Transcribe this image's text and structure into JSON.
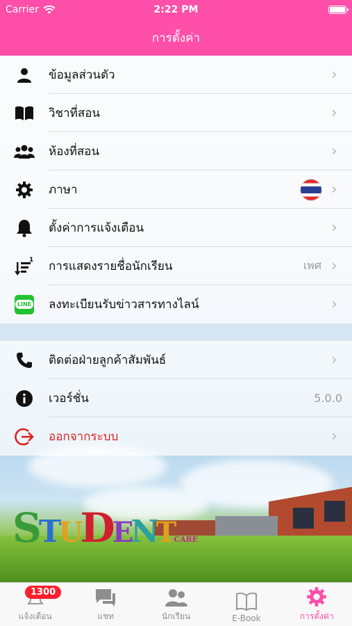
{
  "status": {
    "carrier": "Carrier",
    "time": "2:22 PM"
  },
  "nav": {
    "title": "การตั้งค่า"
  },
  "menu": {
    "group1": [
      {
        "label": "ข้อมูลส่วนตัว",
        "icon": "person-icon",
        "value": ""
      },
      {
        "label": "วิชาที่สอน",
        "icon": "book-icon",
        "value": ""
      },
      {
        "label": "ห้องที่สอน",
        "icon": "group-icon",
        "value": ""
      },
      {
        "label": "ภาษา",
        "icon": "gear-icon",
        "value": ""
      },
      {
        "label": "ตั้งค่าการแจ้งเตือน",
        "icon": "bell-icon",
        "value": ""
      },
      {
        "label": "การแสดงรายชื่อนักเรียน",
        "icon": "sort-icon",
        "value": "เพศ"
      },
      {
        "label": "ลงทะเบียนรับข่าวสารทางไลน์",
        "icon": "line-icon",
        "value": ""
      }
    ],
    "group2": [
      {
        "label": "ติดต่อฝ่ายลูกค้าสัมพันธ์",
        "icon": "phone-icon",
        "value": ""
      },
      {
        "label": "เวอร์ชั่น",
        "icon": "info-icon",
        "value": "5.0.0"
      },
      {
        "label": "ออกจากระบบ",
        "icon": "logout-icon",
        "value": ""
      }
    ],
    "line_badge": "LINE"
  },
  "logo": {
    "letters": [
      "S",
      "T",
      "U",
      "D",
      "E",
      "N",
      "T"
    ],
    "sub": "CARE"
  },
  "tabs": [
    {
      "label": "แจ้งเตือน",
      "icon": "bell-tab-icon",
      "badge": "1300"
    },
    {
      "label": "แชท",
      "icon": "chat-icon",
      "badge": ""
    },
    {
      "label": "นักเรียน",
      "icon": "students-icon",
      "badge": ""
    },
    {
      "label": "E-Book",
      "icon": "ebook-icon",
      "badge": ""
    },
    {
      "label": "การตั้งค่า",
      "icon": "settings-tab-icon",
      "badge": ""
    }
  ],
  "colors": {
    "brand": "#ff4fa9",
    "logout": "#e02020",
    "line": "#22c232",
    "badge": "#ff1f2d"
  }
}
